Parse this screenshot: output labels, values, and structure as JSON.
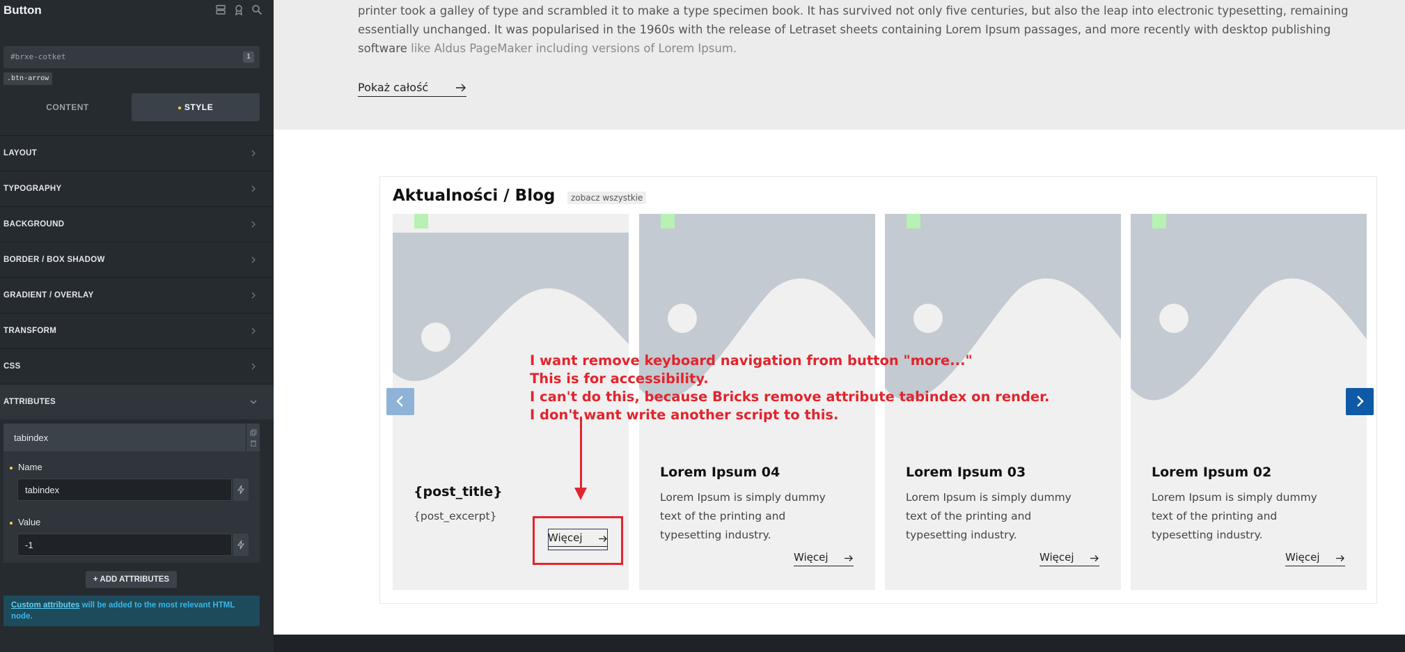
{
  "panel": {
    "title": "Button",
    "selector_id": "#brxe-cotket",
    "selector_count": "1",
    "class_chip": ".btn-arrow",
    "tabs": {
      "content": "CONTENT",
      "style": "STYLE"
    },
    "sections": [
      "LAYOUT",
      "TYPOGRAPHY",
      "BACKGROUND",
      "BORDER / BOX SHADOW",
      "GRADIENT / OVERLAY",
      "TRANSFORM",
      "CSS",
      "ATTRIBUTES"
    ],
    "attribute": {
      "header": "tabindex",
      "name_label": "Name",
      "name_value": "tabindex",
      "value_label": "Value",
      "value_value": "-1"
    },
    "add_button": "ADD ATTRIBUTES",
    "info_link": "Custom attributes",
    "info_rest": " will be added to the most relevant HTML node."
  },
  "hero": {
    "text_1": "printer took a galley of type and scrambled it to make a type specimen book. It has survived not only five centuries, but also the leap into electronic typesetting, remaining essentially unchanged. It was popularised in the 1960s with the release of Letraset sheets containing Lorem Ipsum passages, and more recently with desktop publishing software",
    "text_2": "like Aldus PageMaker including versions of Lorem Ipsum.",
    "show_more": "Pokaż całość"
  },
  "blog": {
    "title": "Aktualności / Blog",
    "see_all": "zobacz wszystkie",
    "cards": [
      {
        "title": "{post_title}",
        "excerpt": "{post_excerpt}",
        "more": "Więcej"
      },
      {
        "title": "Lorem Ipsum 04",
        "excerpt": "Lorem Ipsum is simply dummy text of the printing and typesetting industry.",
        "more": "Więcej"
      },
      {
        "title": "Lorem Ipsum 03",
        "excerpt": "Lorem Ipsum is simply dummy text of the printing and typesetting industry.",
        "more": "Więcej"
      },
      {
        "title": "Lorem Ipsum 02",
        "excerpt": "Lorem Ipsum is simply dummy text of the printing and typesetting industry.",
        "more": "Więcej"
      }
    ]
  },
  "annotation": {
    "line_1": "I want remove keyboard navigation from button \"more...\"",
    "line_2": "This is for accessibility.",
    "line_3": "I can't do this, because Bricks remove attribute tabindex on render.",
    "line_4": "I don't want write another script to this."
  },
  "colors": {
    "accent_yellow": "#ffd64f",
    "annotation_red": "#e2242d",
    "nav_blue": "#0f5aa6",
    "info_blue": "#39b8e6"
  },
  "icons": [
    "layers-icon",
    "badge-icon",
    "search-icon",
    "chevron-right-icon",
    "chevron-down-icon",
    "copy-icon",
    "trash-icon",
    "dynamic-data-icon",
    "plus-icon",
    "arrow-right-icon",
    "chevron-left-icon",
    "image-placeholder-icon"
  ]
}
